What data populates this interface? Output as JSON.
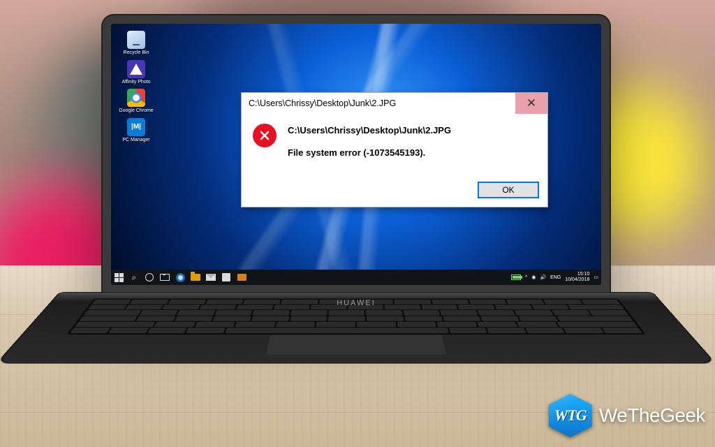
{
  "desktop": {
    "icons": [
      {
        "name": "recycle-bin",
        "label": "Recycle Bin"
      },
      {
        "name": "affinity-photo",
        "label": "Affinity Photo"
      },
      {
        "name": "google-chrome",
        "label": "Google Chrome"
      },
      {
        "name": "pc-manager",
        "label": "PC Manager"
      }
    ]
  },
  "dialog": {
    "title": "C:\\Users\\Chrissy\\Desktop\\Junk\\2.JPG",
    "path": "C:\\Users\\Chrissy\\Desktop\\Junk\\2.JPG",
    "message": "File system error (-1073545193).",
    "ok_label": "OK",
    "close_glyph": "✕",
    "icon": "error-icon"
  },
  "taskbar": {
    "left_icons": [
      "start",
      "search",
      "cortana",
      "task-view",
      "edge",
      "file-explorer",
      "mail",
      "store",
      "3dmark"
    ],
    "tray": {
      "battery": "battery-icon",
      "chevron": "^",
      "wifi": "wifi-icon",
      "sound": "sound-icon",
      "lang": "ENG",
      "time": "15:10",
      "date": "10/04/2018",
      "notif": "notification-icon"
    }
  },
  "laptop": {
    "brand": "HUAWEI"
  },
  "watermark": {
    "badge": "WTG",
    "text_pre": "We",
    "text_mid": "The",
    "text_post": "Geek"
  }
}
